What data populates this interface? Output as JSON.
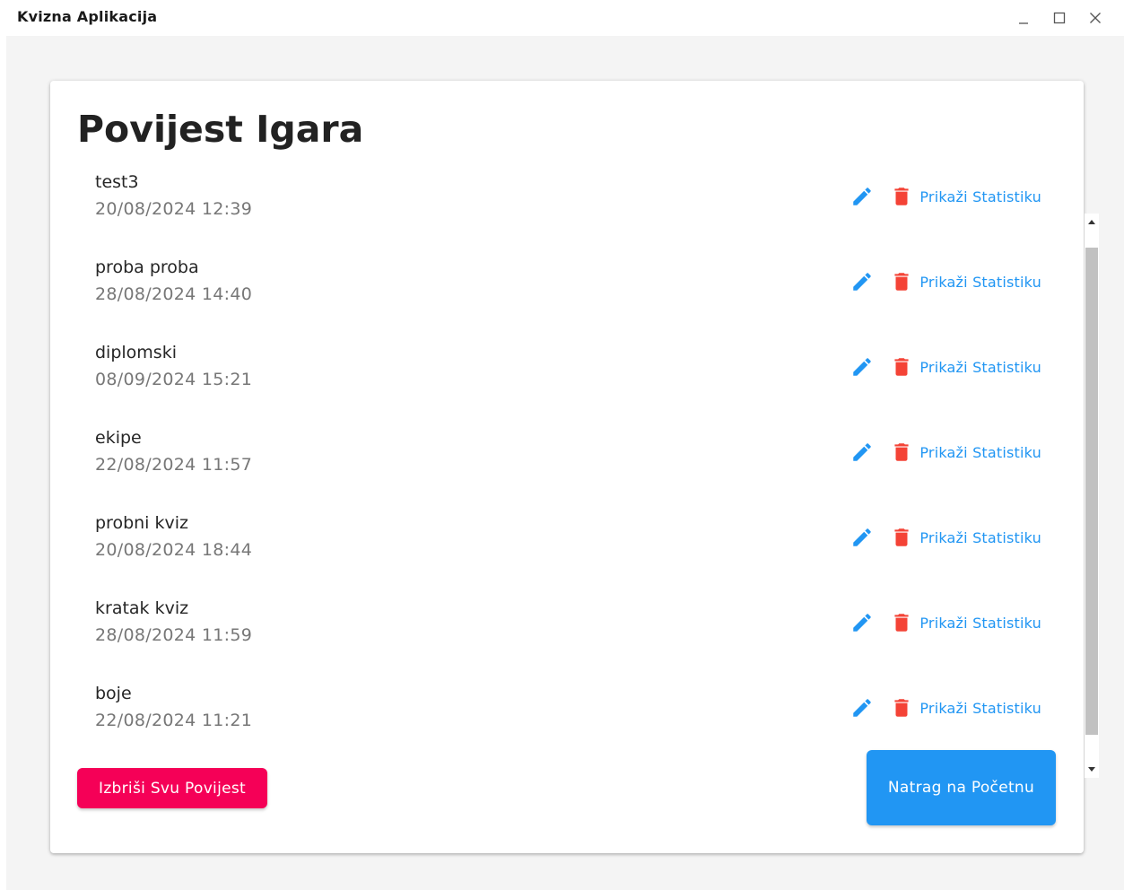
{
  "window": {
    "title": "Kvizna Aplikacija",
    "controls": [
      "minimize-icon",
      "maximize-icon",
      "close-icon"
    ]
  },
  "page": {
    "title": "Povijest Igara"
  },
  "games": [
    {
      "name": "test3",
      "date": "20/08/2024 12:39",
      "stats_label": "Prikaži Statistiku"
    },
    {
      "name": "proba proba",
      "date": "28/08/2024 14:40",
      "stats_label": "Prikaži Statistiku"
    },
    {
      "name": "diplomski",
      "date": "08/09/2024 15:21",
      "stats_label": "Prikaži Statistiku"
    },
    {
      "name": "ekipe",
      "date": "22/08/2024 11:57",
      "stats_label": "Prikaži Statistiku"
    },
    {
      "name": "probni kviz",
      "date": "20/08/2024 18:44",
      "stats_label": "Prikaži Statistiku"
    },
    {
      "name": "kratak kviz",
      "date": "28/08/2024 11:59",
      "stats_label": "Prikaži Statistiku"
    },
    {
      "name": "boje",
      "date": "22/08/2024 11:21",
      "stats_label": "Prikaži Statistiku"
    }
  ],
  "icons": {
    "edit": "pencil-icon",
    "delete": "trash-icon"
  },
  "buttons": {
    "clear_history": "Izbriši Svu Povijest",
    "back_home": "Natrag na Početnu"
  },
  "colors": {
    "accent_blue": "#2196f3",
    "delete_red": "#f44336",
    "clear_pink": "#f50057"
  }
}
